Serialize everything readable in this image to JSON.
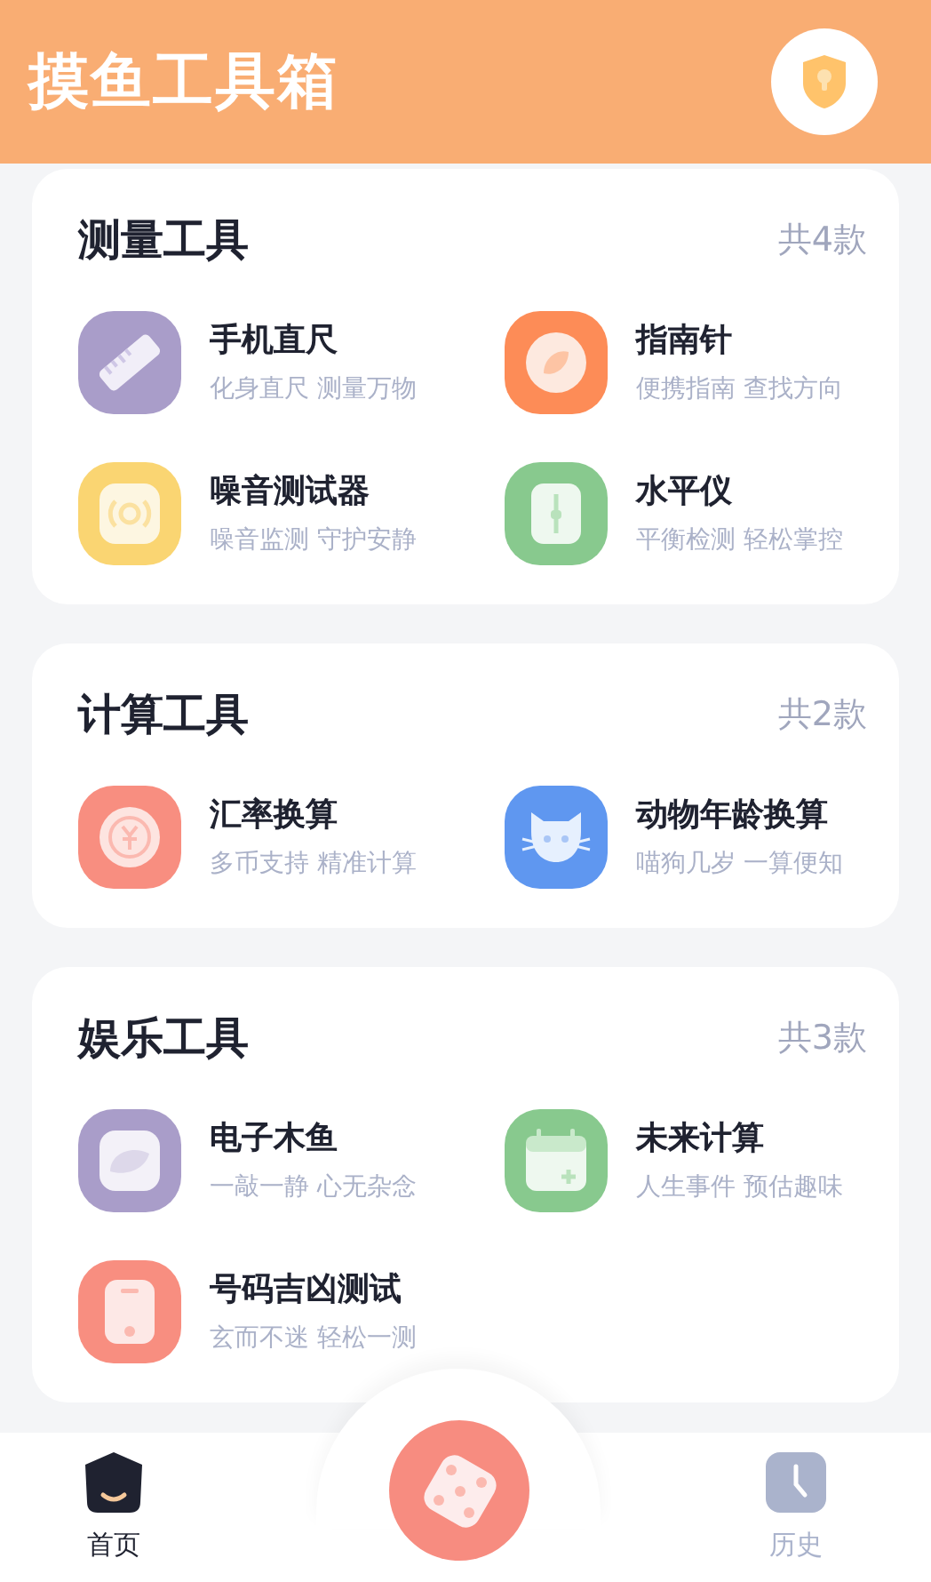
{
  "app_title": "摸鱼工具箱",
  "sections": [
    {
      "title": "测量工具",
      "count": "共4款",
      "tools": [
        {
          "kind": "ruler",
          "color": "#a99dc9",
          "name": "手机直尺",
          "desc": "化身直尺 测量万物"
        },
        {
          "kind": "compass",
          "color": "#fd8c57",
          "name": "指南针",
          "desc": "便携指南 查找方向"
        },
        {
          "kind": "noise",
          "color": "#fad572",
          "name": "噪音测试器",
          "desc": "噪音监测 守护安静"
        },
        {
          "kind": "level",
          "color": "#88c98e",
          "name": "水平仪",
          "desc": "平衡检测 轻松掌控"
        }
      ]
    },
    {
      "title": "计算工具",
      "count": "共2款",
      "tools": [
        {
          "kind": "currency",
          "color": "#f88e80",
          "name": "汇率换算",
          "desc": "多币支持 精准计算"
        },
        {
          "kind": "cat",
          "color": "#5f97f0",
          "name": "动物年龄换算",
          "desc": "喵狗几岁 一算便知"
        }
      ]
    },
    {
      "title": "娱乐工具",
      "count": "共3款",
      "tools": [
        {
          "kind": "fish",
          "color": "#a99dc9",
          "name": "电子木鱼",
          "desc": "一敲一静 心无杂念"
        },
        {
          "kind": "calendar",
          "color": "#88c98e",
          "name": "未来计算",
          "desc": "人生事件 预估趣味"
        },
        {
          "kind": "phone",
          "color": "#f88e80",
          "name": "号码吉凶测试",
          "desc": "玄而不迷 轻松一测"
        }
      ]
    }
  ],
  "tabs": [
    {
      "kind": "home",
      "label": "首页",
      "selected": true
    },
    {
      "kind": "dice",
      "selected": false
    },
    {
      "kind": "history",
      "label": "历史",
      "selected": false
    }
  ]
}
